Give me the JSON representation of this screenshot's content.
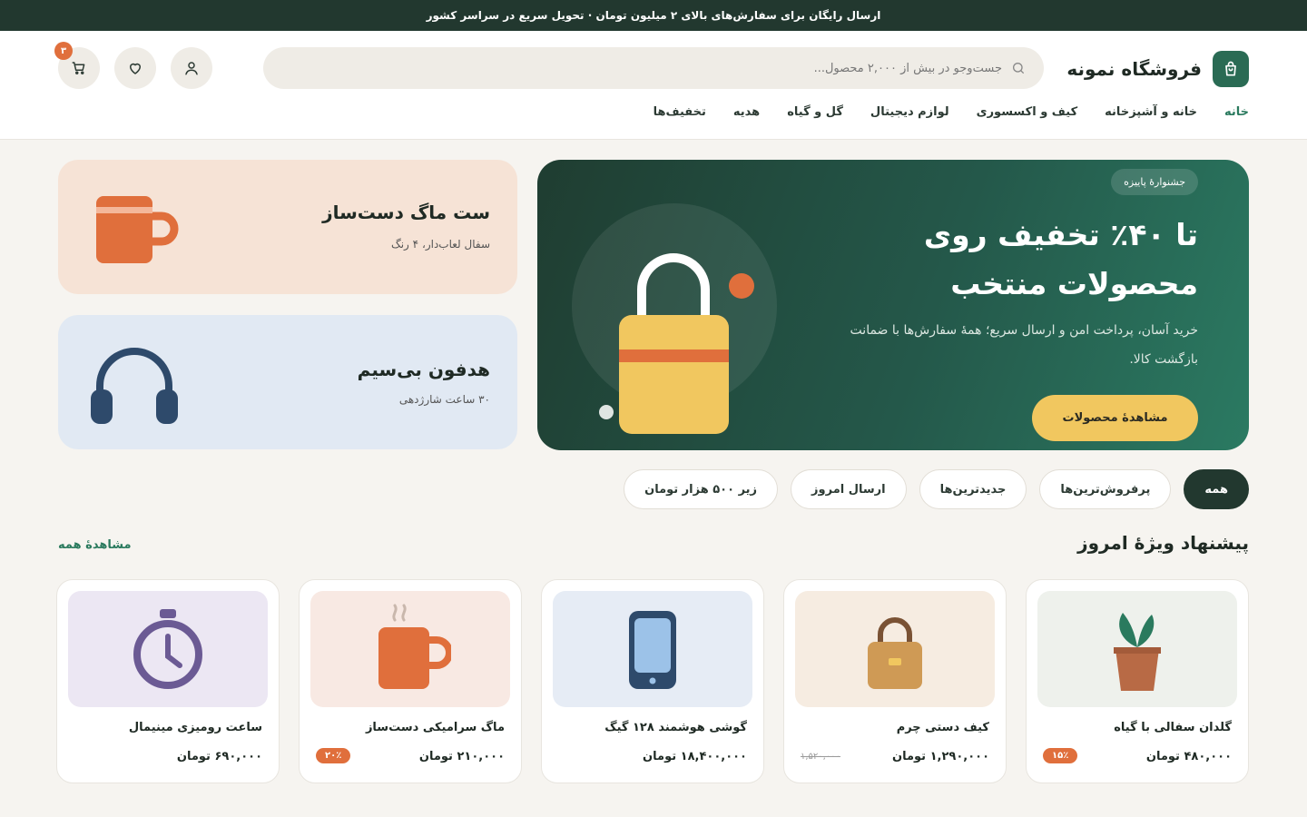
{
  "topbar": {
    "text": "ارسال رایگان برای سفارش‌های بالای ۲ میلیون تومان · تحویل سریع در سراسر کشور"
  },
  "header": {
    "brand": "فروشگاه نمونه",
    "search_placeholder": "جست‌وجو در بیش از ۲,۰۰۰ محصول...",
    "cart_count": "۳"
  },
  "nav": {
    "items": [
      "خانه",
      "خانه و آشپزخانه",
      "کیف و اکسسوری",
      "لوازم دیجیتال",
      "گل و گیاه",
      "هدیه",
      "تخفیف‌ها"
    ]
  },
  "hero": {
    "pill": "جشنوارهٔ پاییزه",
    "title_line1": "تا ۴۰٪ تخفیف روی",
    "title_line2": "محصولات منتخب",
    "subtitle": "خرید آسان، پرداخت امن و ارسال سریع؛ همهٔ سفارش‌ها با ضمانت بازگشت کالا.",
    "button": "مشاهدهٔ محصولات",
    "colors": {
      "bag": "#f1c75f",
      "stripe": "#e06f3c"
    }
  },
  "side_cards": [
    {
      "title": "ست ماگ دست‌ساز",
      "subtitle": "سفال لعاب‌دار، ۴ رنگ",
      "bg": "#f6e3d6"
    },
    {
      "title": "هدفون بی‌سیم",
      "subtitle": "۳۰ ساعت شارژدهی",
      "bg": "#e1e9f3"
    }
  ],
  "chips": [
    "همه",
    "پرفروش‌ترین‌ها",
    "جدیدترین‌ها",
    "ارسال امروز",
    "زیر ۵۰۰ هزار تومان"
  ],
  "section": {
    "title": "پیشنهاد ویژهٔ امروز",
    "see_all": "مشاهدهٔ همه"
  },
  "products": [
    {
      "name": "گلدان سفالی با گیاه",
      "price": "۴۸۰,۰۰۰ تومان",
      "badge": "۱۵٪",
      "old_price": "",
      "icon": "plant-pot-icon",
      "bg": "#eef1ec"
    },
    {
      "name": "کیف دستی چرم",
      "price": "۱,۲۹۰,۰۰۰ تومان",
      "badge": "",
      "old_price": "۱,۵۲۰,۰۰۰",
      "icon": "handbag-icon",
      "bg": "#f6ece1"
    },
    {
      "name": "گوشی هوشمند ۱۲۸ گیگ",
      "price": "۱۸,۴۰۰,۰۰۰ تومان",
      "badge": "",
      "old_price": "",
      "icon": "smartphone-icon",
      "bg": "#e6ecf5"
    },
    {
      "name": "ماگ سرامیکی دست‌ساز",
      "price": "۲۱۰,۰۰۰ تومان",
      "badge": "۲۰٪",
      "old_price": "",
      "icon": "mug-icon",
      "bg": "#f8e9e3"
    },
    {
      "name": "ساعت رومیزی مینیمال",
      "price": "۶۹۰,۰۰۰ تومان",
      "badge": "",
      "old_price": "",
      "icon": "clock-icon",
      "bg": "#ece7f3"
    }
  ]
}
